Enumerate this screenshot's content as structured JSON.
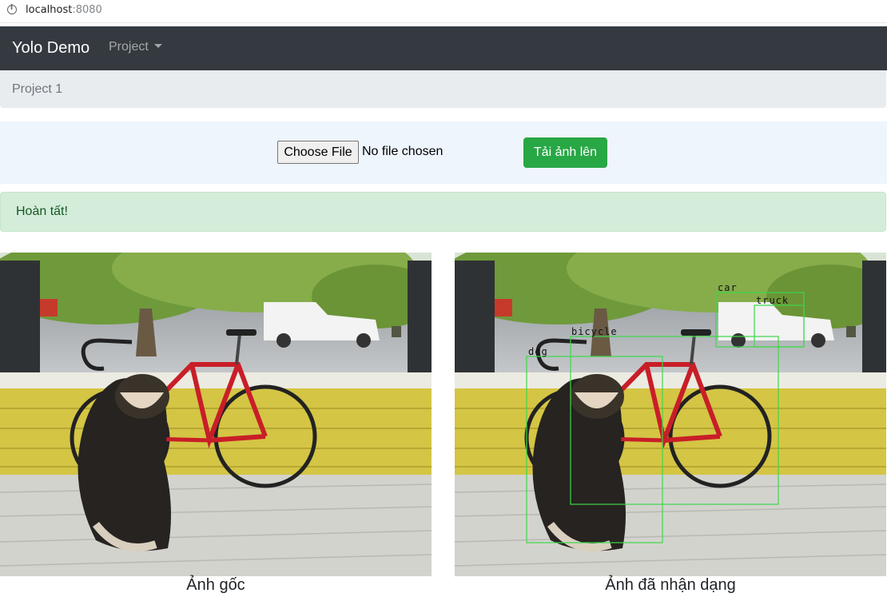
{
  "browser": {
    "host": "localhost",
    "port": ":8080"
  },
  "navbar": {
    "brand": "Yolo Demo",
    "menu_label": "Project"
  },
  "breadcrumb": {
    "current": "Project 1"
  },
  "upload": {
    "choose_label": "Choose File",
    "status": "No file chosen",
    "submit_label": "Tải ảnh lên"
  },
  "alert": {
    "message": "Hoàn tất!"
  },
  "images": {
    "original_caption": "Ảnh gốc",
    "detected_caption": "Ảnh đã nhận dạng",
    "detections": [
      "car",
      "truck",
      "bicycle",
      "dog"
    ],
    "box_color": "#3cd84a"
  },
  "colors": {
    "navbar": "#343a40",
    "success": "#28a745",
    "alert_bg": "#d4edda"
  }
}
